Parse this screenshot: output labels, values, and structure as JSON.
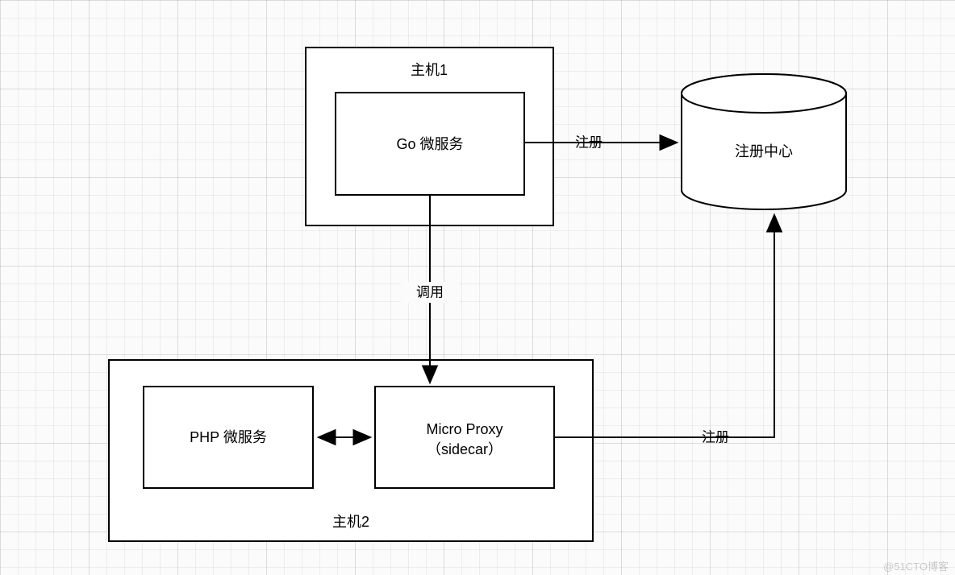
{
  "hosts": {
    "host1": {
      "title": "主机1"
    },
    "host2": {
      "title": "主机2"
    }
  },
  "nodes": {
    "go": {
      "label": "Go 微服务"
    },
    "php": {
      "label": "PHP 微服务"
    },
    "proxy": {
      "line1": "Micro Proxy",
      "line2": "（sidecar）"
    },
    "registry": {
      "label": "注册中心"
    }
  },
  "edges": {
    "register1": {
      "label": "注册"
    },
    "call": {
      "label": "调用"
    },
    "register2": {
      "label": "注册"
    }
  },
  "watermark": "@51CTO博客"
}
